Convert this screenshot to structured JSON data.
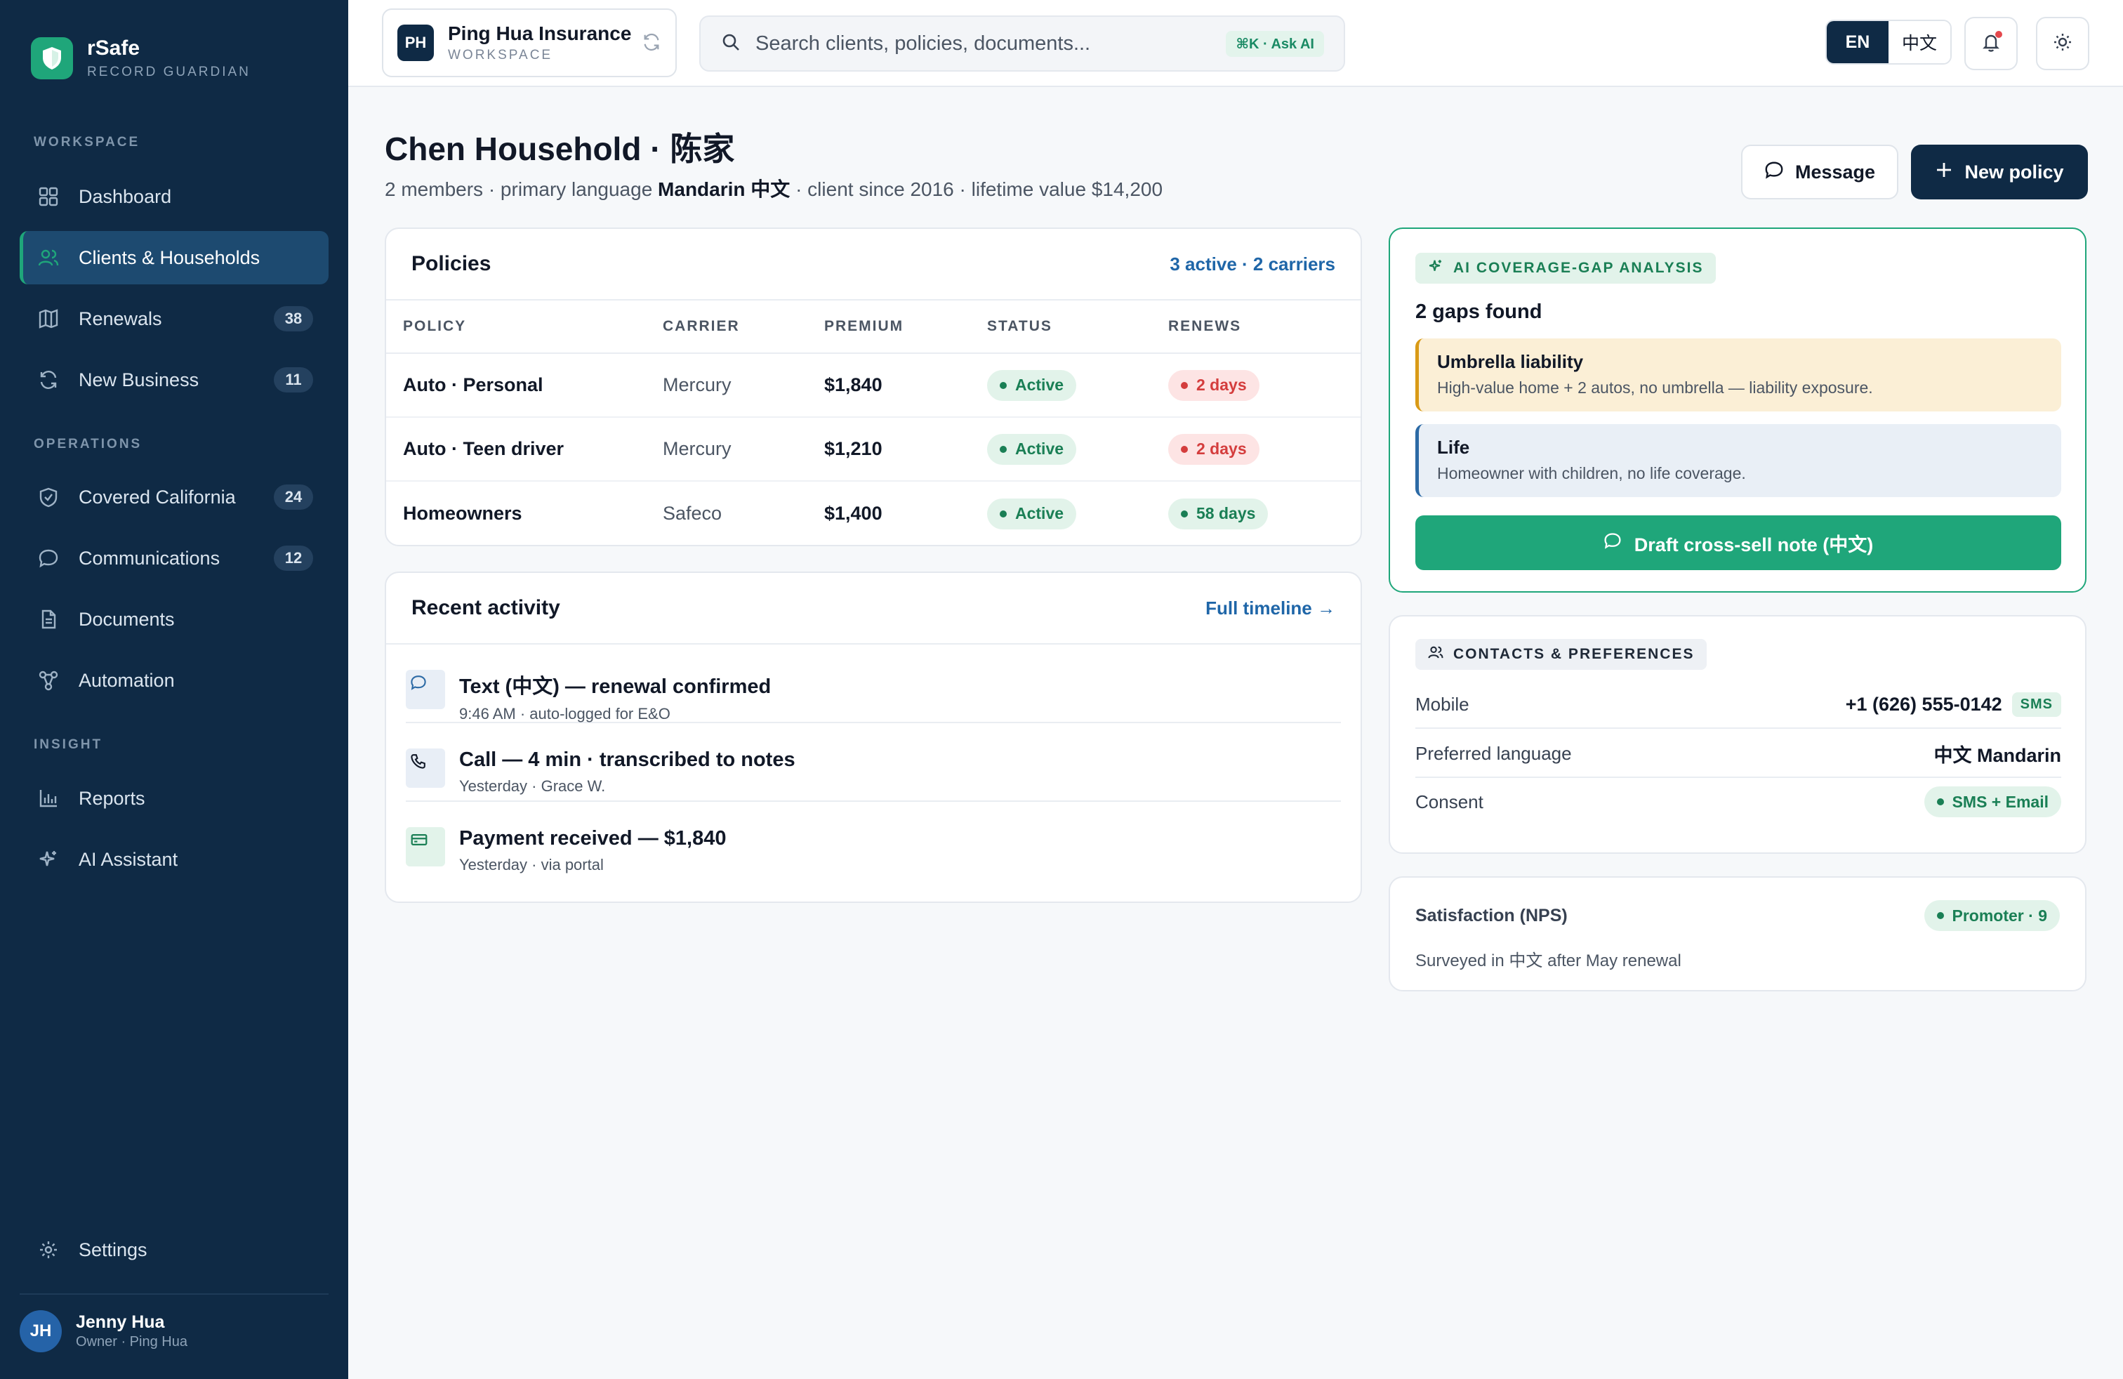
{
  "brand": {
    "name": "rSafe",
    "tagline": "RECORD GUARDIAN"
  },
  "sidebar": {
    "sections": [
      "WORKSPACE",
      "OPERATIONS",
      "INSIGHT"
    ],
    "items": [
      {
        "label": "Dashboard",
        "icon": "grid-icon",
        "badge": null
      },
      {
        "label": "Clients & Households",
        "icon": "users-icon",
        "badge": null,
        "active": true
      },
      {
        "label": "Renewals",
        "icon": "map-icon",
        "badge": "38"
      },
      {
        "label": "New Business",
        "icon": "refresh-icon",
        "badge": "11"
      },
      {
        "label": "Covered California",
        "icon": "shield-check-icon",
        "badge": "24"
      },
      {
        "label": "Communications",
        "icon": "chat-icon",
        "badge": "12"
      },
      {
        "label": "Documents",
        "icon": "document-icon",
        "badge": null
      },
      {
        "label": "Automation",
        "icon": "workflow-icon",
        "badge": null
      },
      {
        "label": "Reports",
        "icon": "bar-chart-icon",
        "badge": null
      },
      {
        "label": "AI Assistant",
        "icon": "sparkle-icon",
        "badge": null
      }
    ],
    "settings_label": "Settings",
    "user": {
      "initials": "JH",
      "name": "Jenny Hua",
      "role": "Owner · Ping Hua"
    }
  },
  "topbar": {
    "workspace": {
      "initials": "PH",
      "name": "Ping Hua Insurance",
      "sub": "WORKSPACE"
    },
    "search": {
      "placeholder": "Search clients, policies, documents...",
      "shortcut": "⌘K · Ask AI"
    },
    "lang": {
      "en": "EN",
      "zh": "中文",
      "selected": "EN"
    }
  },
  "header": {
    "title": "Chen Household · 陈家",
    "sub_prefix": "2 members · primary language ",
    "sub_language": "Mandarin 中文",
    "sub_suffix": " · client since 2016 · lifetime value $14,200",
    "message_label": "Message",
    "new_policy_label": "New policy"
  },
  "policies": {
    "title": "Policies",
    "summary": "3 active · 2 carriers",
    "columns": [
      "POLICY",
      "CARRIER",
      "PREMIUM",
      "STATUS",
      "RENEWS"
    ],
    "rows": [
      {
        "policy": "Auto · Personal",
        "carrier": "Mercury",
        "premium": "$1,840",
        "status": "Active",
        "renews": "2 days",
        "renews_color": "#d43d3d"
      },
      {
        "policy": "Auto · Teen driver",
        "carrier": "Mercury",
        "premium": "$1,210",
        "status": "Active",
        "renews": "2 days",
        "renews_color": "#d43d3d"
      },
      {
        "policy": "Homeowners",
        "carrier": "Safeco",
        "premium": "$1,400",
        "status": "Active",
        "renews": "58 days",
        "renews_color": "#1a7f55"
      }
    ]
  },
  "activity": {
    "title": "Recent activity",
    "link": "Full timeline →",
    "items": [
      {
        "title": "Text (中文) — renewal confirmed",
        "meta": "9:46 AM · auto-logged for E&O",
        "icon": "chat-icon"
      },
      {
        "title": "Call — 4 min · transcribed to notes",
        "meta": "Yesterday · Grace W.",
        "icon": "phone-icon"
      },
      {
        "title": "Payment received — $1,840",
        "meta": "Yesterday · via portal",
        "icon": "credit-card-icon"
      }
    ]
  },
  "ai_analysis": {
    "tag": "AI COVERAGE-GAP ANALYSIS",
    "title": "2 gaps found",
    "gaps": [
      {
        "title": "Umbrella liability",
        "desc": "High-value home + 2 autos, no umbrella — liability exposure."
      },
      {
        "title": "Life",
        "desc": "Homeowner with children, no life coverage."
      }
    ],
    "cta": "Draft cross-sell note (中文)"
  },
  "contacts": {
    "tag": "CONTACTS & PREFERENCES",
    "rows": [
      {
        "label": "Mobile",
        "value": "+1 (626) 555-0142",
        "badge": "SMS"
      },
      {
        "label": "Preferred language",
        "value": "中文 Mandarin"
      },
      {
        "label": "Consent",
        "value": "SMS + Email"
      }
    ]
  },
  "satisfaction": {
    "label": "Satisfaction (NPS)",
    "badge": "Promoter · 9",
    "desc": "Surveyed in 中文 after May renewal"
  },
  "colors": {
    "sidebar": "#0f2a45",
    "accent": "#1fa67a",
    "link": "#1f66a8",
    "danger": "#d43d3d"
  }
}
